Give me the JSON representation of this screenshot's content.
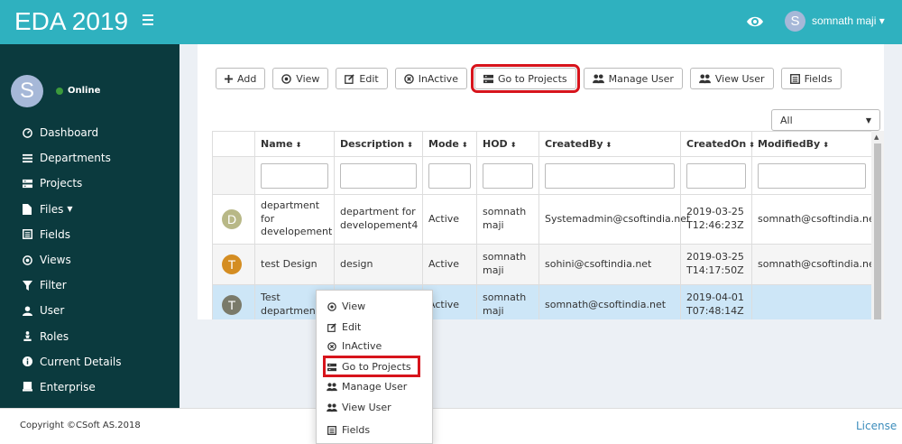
{
  "header": {
    "title": "EDA 2019",
    "user_initial": "S",
    "user_name": "somnath maji"
  },
  "sidebar": {
    "avatar_initial": "S",
    "status": "Online",
    "items": [
      {
        "label": "Dashboard",
        "icon": "dashboard-icon"
      },
      {
        "label": "Departments",
        "icon": "list-icon"
      },
      {
        "label": "Projects",
        "icon": "server-icon"
      },
      {
        "label": "Files",
        "icon": "file-icon"
      },
      {
        "label": "Fields",
        "icon": "fields-icon"
      },
      {
        "label": "Views",
        "icon": "eye-circle-icon"
      },
      {
        "label": "Filter",
        "icon": "filter-icon"
      },
      {
        "label": "User",
        "icon": "user-icon"
      },
      {
        "label": "Roles",
        "icon": "chess-icon"
      },
      {
        "label": "Current Details",
        "icon": "info-icon"
      },
      {
        "label": "Enterprise",
        "icon": "building-icon"
      }
    ]
  },
  "toolbar": {
    "add": "Add",
    "view": "View",
    "edit": "Edit",
    "inactive": "InActive",
    "go_to_projects": "Go to Projects",
    "manage_user": "Manage User",
    "view_user": "View User",
    "fields": "Fields"
  },
  "filter": {
    "selected": "All"
  },
  "table": {
    "columns": [
      "Name",
      "Description",
      "Mode",
      "HOD",
      "CreatedBy",
      "CreatedOn",
      "ModifiedBy"
    ],
    "rows": [
      {
        "initial": "D",
        "color": "#b8b887",
        "name": "department for developement",
        "description": "department for developement4",
        "mode": "Active",
        "hod": "somnath maji",
        "created_by": "Systemadmin@csoftindia.net",
        "created_on": "2019-03-25T12:46:23Z",
        "modified_by": "somnath@csoftindia.net"
      },
      {
        "initial": "T",
        "color": "#d48d22",
        "name": "test Design",
        "description": "design",
        "mode": "Active",
        "hod": "somnath maji",
        "created_by": "sohini@csoftindia.net",
        "created_on": "2019-03-25T14:17:50Z",
        "modified_by": "somnath@csoftindia.net"
      },
      {
        "initial": "T",
        "color": "#7a7a6a",
        "name": "Test department",
        "description": "",
        "mode": "Active",
        "hod": "somnath maji",
        "created_by": "somnath@csoftindia.net",
        "created_on": "2019-04-01T07:48:14Z",
        "modified_by": ""
      }
    ]
  },
  "context_menu": {
    "items": [
      "View",
      "Edit",
      "InActive",
      "Go to Projects",
      "Manage User",
      "View User",
      "Fields"
    ]
  },
  "footer": {
    "copyright": "Copyright ©CSoft AS.2018",
    "license": "License"
  },
  "colors": {
    "header": "#2fb1bf",
    "sidebar": "#0b3a3e",
    "highlight": "#d7141c",
    "selected_row": "#cde6f7"
  }
}
